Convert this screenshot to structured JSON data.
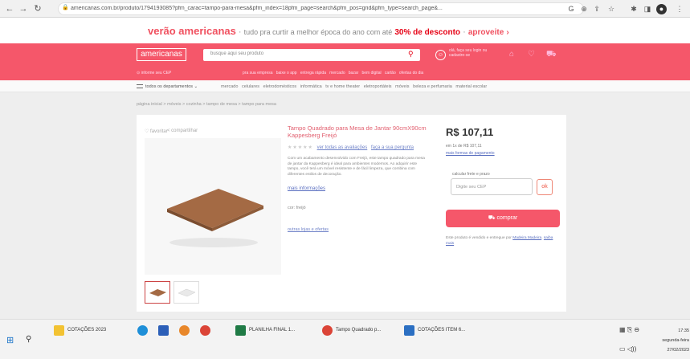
{
  "browser": {
    "url": "americanas.com.br/produto/1794193085?pfm_carac=tampo-para-mesa&pfm_index=18pfm_page=search&pfm_pos=grid&pfm_type=search_page&..."
  },
  "promo": {
    "brand": "verão americanas",
    "text": "tudo pra curtir a melhor época do ano com até",
    "highlight": "30% de desconto",
    "cta": "aproveite"
  },
  "header": {
    "logo": "americanas",
    "search_placeholder": "busque aqui seu produto",
    "user_text": "olá, faça seu login ou cadastre-se",
    "location_text": "informe seu CEP",
    "subnav": [
      "pra sua empresa",
      "baixe o app",
      "entrega rápida",
      "mercado",
      "bazar",
      "bem digital",
      "cartão",
      "ofertas do dia"
    ]
  },
  "departments": {
    "menu_label": "todos os departamentos",
    "links": [
      "mercado",
      "celulares",
      "eletrodomésticos",
      "informática",
      "tv e home theater",
      "eletroportáteis",
      "móveis",
      "beleza e perfumaria",
      "material escolar"
    ]
  },
  "breadcrumb": "página inicial > móveis > cozinha > tampo de mesa > tampo para mesa",
  "product": {
    "favorite": "favoritar",
    "share": "compartilhar",
    "title": "Tampo Quadrado para Mesa de Jantar 90cmX90cm Kappesberg Freijó",
    "rating_links": [
      "ver todas as avaliações",
      "faça a sua pergunta"
    ],
    "description": "Com um acabamento desenvolvido com Freijó, este tampo quadrado para mesa de jantar da Kappesberg é ideal para ambientes modernos. Ao adquirir este tampo, você terá um móvel resistente e de fácil limpeza, que combina com diferentes estilos de decoração.",
    "more_info": "mais informações",
    "color": "cor: freijó",
    "other_sellers": "outras lojas e ofertas",
    "price": "R$ 107,11",
    "installment": "em 1x de R$ 107,11",
    "payment_link": "mais formas de pagamento",
    "cep_label": "calcular frete e prazo",
    "cep_placeholder": "Digite seu CEP",
    "cep_button": "ok",
    "buy_button": "comprar",
    "seller_note": "Este produto é vendido e entregue por",
    "seller_name": "Madeira Madeira",
    "seller_link": "saiba mais"
  },
  "taskbar": {
    "items": [
      "COTAÇÕES 2023",
      "PLANILHA FINAL 1...",
      "Tampo Quadrado p...",
      "COTAÇÕES ITEM 6..."
    ],
    "time": "17:35",
    "day": "segunda-feira",
    "date": "27/02/2023"
  }
}
